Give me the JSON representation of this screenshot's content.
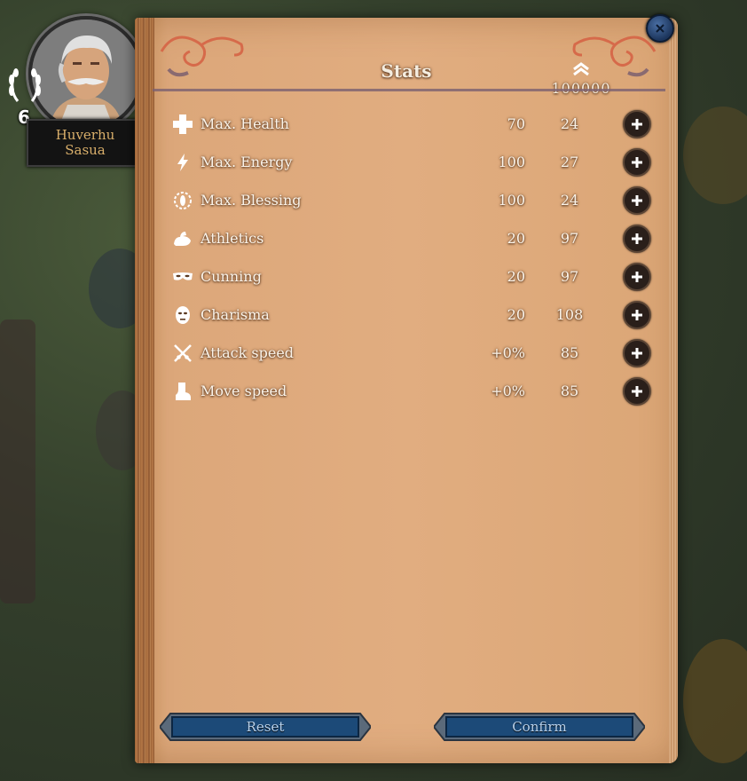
{
  "character": {
    "name_line1": "Huverhu",
    "name_line2": "Sasua",
    "level": "6"
  },
  "panel": {
    "title": "Stats",
    "points": "100000"
  },
  "stats": [
    {
      "name": "Max. Health",
      "value": "70",
      "cost": "24",
      "icon": "health-cross-icon"
    },
    {
      "name": "Max. Energy",
      "value": "100",
      "cost": "27",
      "icon": "energy-bolt-icon"
    },
    {
      "name": "Max. Blessing",
      "value": "100",
      "cost": "24",
      "icon": "blessing-icon"
    },
    {
      "name": "Athletics",
      "value": "20",
      "cost": "97",
      "icon": "flexed-arm-icon"
    },
    {
      "name": "Cunning",
      "value": "20",
      "cost": "97",
      "icon": "mask-icon"
    },
    {
      "name": "Charisma",
      "value": "20",
      "cost": "108",
      "icon": "face-icon"
    },
    {
      "name": "Attack speed",
      "value": "+0%",
      "cost": "85",
      "icon": "crossed-swords-icon"
    },
    {
      "name": "Move speed",
      "value": "+0%",
      "cost": "85",
      "icon": "boot-icon"
    }
  ],
  "buttons": {
    "reset": "Reset",
    "confirm": "Confirm"
  },
  "colors": {
    "parchment": "#e1ad80",
    "text": "#fbf4ea",
    "button_blue": "#1c4a78",
    "name_gold": "#d8ae6a"
  }
}
